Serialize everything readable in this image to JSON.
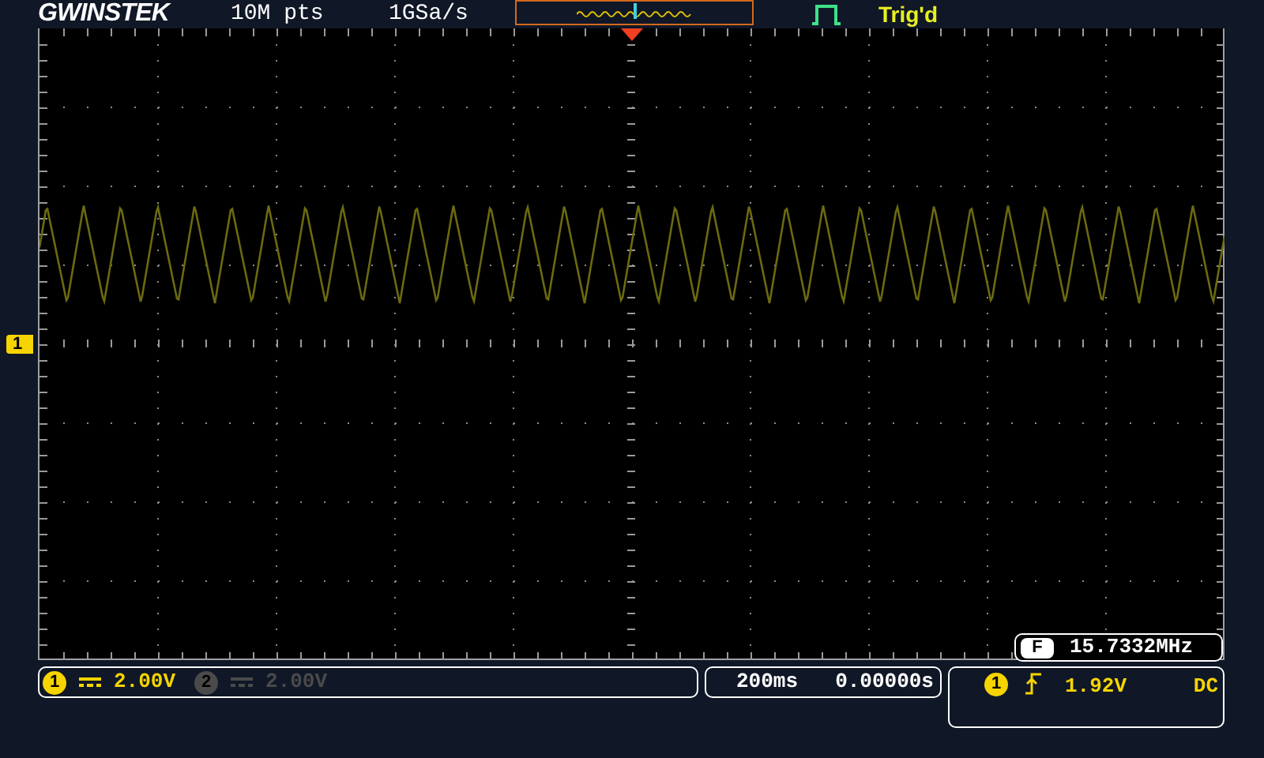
{
  "header": {
    "logo": "GWINSTEK",
    "memory_depth": "10M pts",
    "sample_rate": "1GSa/s",
    "trigger_status": "Trig'd"
  },
  "screen": {
    "channel_marker": "1"
  },
  "frequency_counter": {
    "badge": "F",
    "value": "15.7332MHz"
  },
  "channels": [
    {
      "number": "1",
      "scale": "2.00V",
      "enabled": true
    },
    {
      "number": "2",
      "scale": "2.00V",
      "enabled": false
    }
  ],
  "timebase": {
    "scale": "200ms",
    "position": "0.00000s"
  },
  "trigger": {
    "source": "1",
    "level": "1.92V",
    "coupling": "DC"
  }
}
